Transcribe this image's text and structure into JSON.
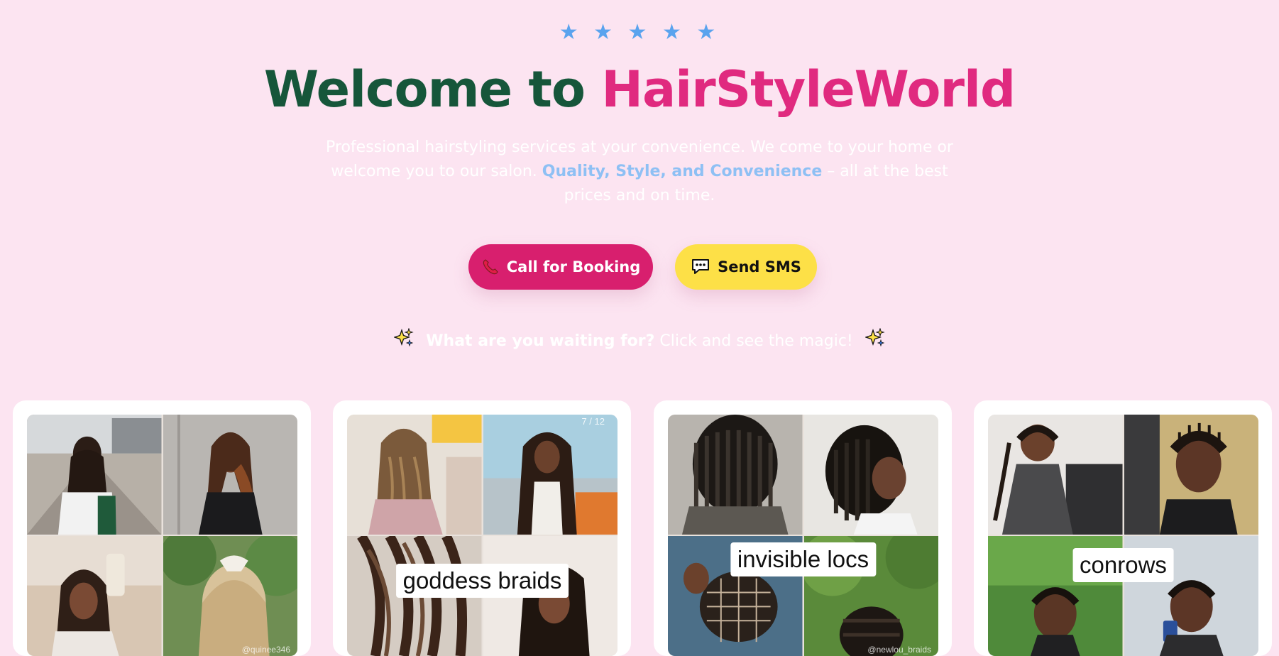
{
  "hero": {
    "rating": {
      "stars": 5,
      "glyphs": "★ ★ ★ ★ ★",
      "color": "#5aa3ee"
    },
    "title_prefix": "Welcome to",
    "title_brand": "HairStyleWorld",
    "subtitle_intro": "Professional hairstyling services at your convenience. We come to your home or welcome you to our salon.",
    "subtitle_highlight": "Quality, Style, and Convenience",
    "subtitle_outro": "– all at the best prices and on time.",
    "colors": {
      "background": "#fce4f1",
      "title_dark": "#16563a",
      "title_brand": "#e02a7f",
      "highlight": "#8ec0f4"
    }
  },
  "actions": {
    "call": {
      "label": "Call for Booking",
      "icon": "telephone-icon",
      "color": "#d81f6e"
    },
    "sms": {
      "label": "Send SMS",
      "icon": "speech-bubble-icon",
      "color": "#fde047"
    }
  },
  "cta": {
    "question": "What are you waiting for?",
    "text": "Click and see the magic!",
    "icon": "sparkles-icon"
  },
  "gallery": {
    "cards": [
      {
        "label": "",
        "watermark": "@quinee346"
      },
      {
        "label": "goddess braids",
        "counter": "7 / 12"
      },
      {
        "label": "invisible locs",
        "watermark": "@newlou_braids"
      },
      {
        "label": "conrows"
      }
    ]
  }
}
